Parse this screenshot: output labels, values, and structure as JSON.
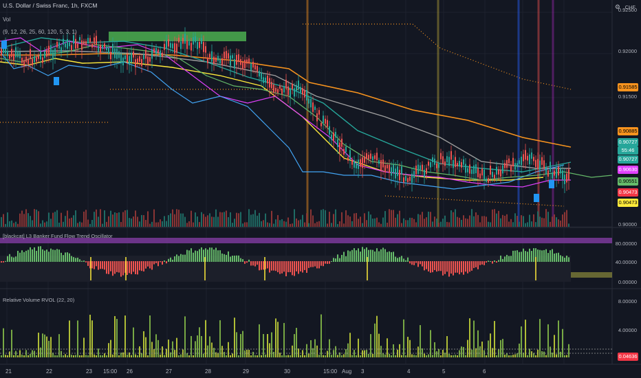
{
  "header": {
    "symbol_title": "U.S. Dollar / Swiss Franc, 1h, FXCM",
    "currency": "CHF",
    "vol_label": "Vol",
    "indicator_params": "(9, 12, 26, 25, 60, 120, 5, 3, 1)"
  },
  "panes": {
    "oscillator_title": "[blackcat] L3 Banker Fund Flow Trend Oscillator",
    "rvol_title": "Relative Volume RVOL (22, 20)"
  },
  "price_axis": [
    "0.92500",
    "0.92000",
    "0.91500",
    "0.90000"
  ],
  "price_tags": [
    {
      "text": "0.91585",
      "color": "#f7931e"
    },
    {
      "text": "0.90885",
      "color": "#f7931e"
    },
    {
      "text": "0.90727",
      "color": "#26a69a"
    },
    {
      "text": "55:46",
      "color": "#26a69a"
    },
    {
      "text": "0.90727",
      "color": "#26a69a"
    },
    {
      "text": "0.90630",
      "color": "#e040fb"
    },
    {
      "text": "0.90551",
      "color": "#66bb6a"
    },
    {
      "text": "0.90473",
      "color": "#f23645"
    },
    {
      "text": "0.90473",
      "color": "#ffeb3b"
    }
  ],
  "osc_axis": [
    "80.00000",
    "40.00000",
    "0.00000"
  ],
  "rvol_axis": [
    "8.00000",
    "4.00000"
  ],
  "rvol_tag": {
    "text": "0.04636",
    "color": "#f23645"
  },
  "dates": [
    "21",
    "22",
    "23",
    "15:00",
    "26",
    "27",
    "28",
    "29",
    "30",
    "15:00",
    "Aug",
    "3",
    "4",
    "5",
    "6"
  ],
  "colors": {
    "background": "#131722",
    "grid": "#1e222d",
    "up": "#26a69a",
    "down": "#ef5350"
  }
}
